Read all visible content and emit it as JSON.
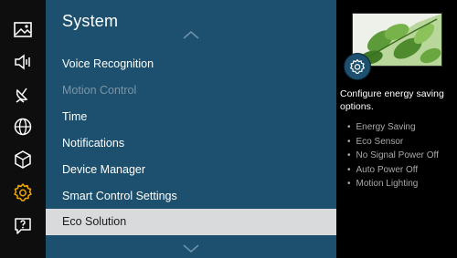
{
  "sidebar": {
    "icons": [
      "picture-icon",
      "sound-icon",
      "broadcasting-icon",
      "network-icon",
      "smart-hub-icon",
      "system-gear-icon",
      "support-icon"
    ],
    "active_color": "#f0a800",
    "default_color": "#ffffff"
  },
  "menu": {
    "title": "System",
    "items": [
      {
        "label": "Voice Recognition",
        "state": "normal"
      },
      {
        "label": "Motion Control",
        "state": "disabled"
      },
      {
        "label": "Time",
        "state": "normal"
      },
      {
        "label": "Notifications",
        "state": "normal"
      },
      {
        "label": "Device Manager",
        "state": "normal"
      },
      {
        "label": "Smart Control Settings",
        "state": "normal"
      },
      {
        "label": "Eco Solution",
        "state": "selected"
      }
    ],
    "background": "#1c506e",
    "selected_background": "#d9dadc"
  },
  "info": {
    "description": "Configure energy saving options.",
    "options": [
      "Energy Saving",
      "Eco Sensor",
      "No Signal Power Off",
      "Auto Power Off",
      "Motion Lighting"
    ]
  }
}
